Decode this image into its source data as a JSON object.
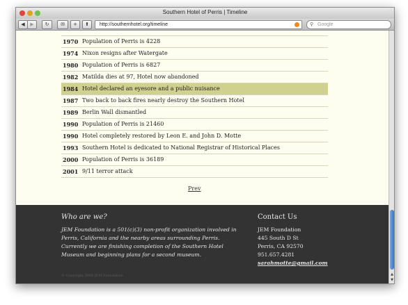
{
  "window": {
    "title": "Southern Hotel of Perris | Timeline"
  },
  "toolbar": {
    "back_icon": "back-arrow",
    "forward_icon": "forward-arrow",
    "reload_icon": "reload",
    "bookmark_icon": "bookmark",
    "add_icon": "plus",
    "share_icon": "share",
    "url": "http://southernhotel.org/timeline",
    "search_placeholder": "Google"
  },
  "timeline": {
    "rows": [
      {
        "year": "1970",
        "event": "Population of Perris is 4228",
        "highlighted": false
      },
      {
        "year": "1974",
        "event": "Nixon resigns after Watergate",
        "highlighted": false
      },
      {
        "year": "1980",
        "event": "Population of Perris is 6827",
        "highlighted": false
      },
      {
        "year": "1982",
        "event": "Matilda dies at 97, Hotel now abandoned",
        "highlighted": false
      },
      {
        "year": "1984",
        "event": "Hotel declared an eyesore and a public nuisance",
        "highlighted": true
      },
      {
        "year": "1987",
        "event": "Two back to back fires nearly destroy the Southern Hotel",
        "highlighted": false
      },
      {
        "year": "1989",
        "event": "Berlin Wall dismantled",
        "highlighted": false
      },
      {
        "year": "1990",
        "event": "Population of Perris is 21460",
        "highlighted": false
      },
      {
        "year": "1990",
        "event": "Hotel completely restored by Leon E. and John D. Motte",
        "highlighted": false
      },
      {
        "year": "1993",
        "event": "Southern Hotel is dedicated to National Registrar of Historical Places",
        "highlighted": false
      },
      {
        "year": "2000",
        "event": "Population of Perris is 36189",
        "highlighted": false
      },
      {
        "year": "2001",
        "event": "9/11 terror attack",
        "highlighted": false
      }
    ],
    "prev_label": "Prev"
  },
  "footer": {
    "who_title": "Who are we?",
    "who_body": "JEM Foundation is a 501(c)(3) non-profit organization involved in Perris, California and the nearby areas surrounding Perris. Currently we are finishing completion of the Southern Hotel Museum and beginning plans for a second museum.",
    "contact_title": "Contact Us",
    "contact_name": "JEM Foundation",
    "contact_street": "445 South D St",
    "contact_city": "Perris, CA 92570",
    "contact_phone": "951.657.4281",
    "contact_email": "sarahmotte@gmail.com",
    "copyright": "© Copyright 2008 JEM Foundation"
  },
  "colors": {
    "page_bg": "#fdfdf0",
    "highlight": "#d0d08f",
    "footer_bg": "#333333"
  }
}
